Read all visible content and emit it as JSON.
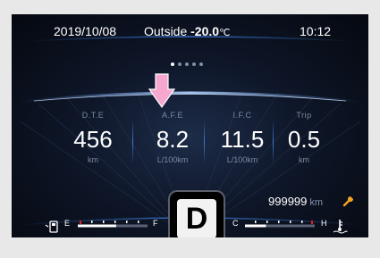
{
  "status": {
    "date": "2019/10/08",
    "outside_label": "Outside",
    "outside_temp": "-20.0",
    "outside_unit": "℃",
    "time": "10:12"
  },
  "pager": {
    "count": 5,
    "active_index": 0
  },
  "stats": [
    {
      "label": "D.T.E",
      "value": "456",
      "unit": "km"
    },
    {
      "label": "A.F.E",
      "value": "8.2",
      "unit": "L/100km"
    },
    {
      "label": "I.F.C",
      "value": "11.5",
      "unit": "L/100km"
    },
    {
      "label": "Trip",
      "value": "0.5",
      "unit": "km"
    }
  ],
  "highlight": {
    "selected_stat": "A.F.E"
  },
  "odometer": {
    "value": "999999",
    "unit": "km"
  },
  "gear": "D",
  "fuel_gauge": {
    "empty_label": "E",
    "full_label": "F",
    "level": 0.55
  },
  "temp_gauge": {
    "cold_label": "C",
    "hot_label": "H",
    "level": 0.3
  },
  "colors": {
    "accent_blue": "#3a79d2",
    "arrow_pink": "#f5a7d0",
    "warning_orange": "#f5a623",
    "gauge_red": "#e02020"
  },
  "icons": {
    "pointer": "down-arrow-icon",
    "service": "wrench-icon",
    "fuel": "fuel-pump-icon",
    "coolant": "coolant-temperature-icon"
  }
}
